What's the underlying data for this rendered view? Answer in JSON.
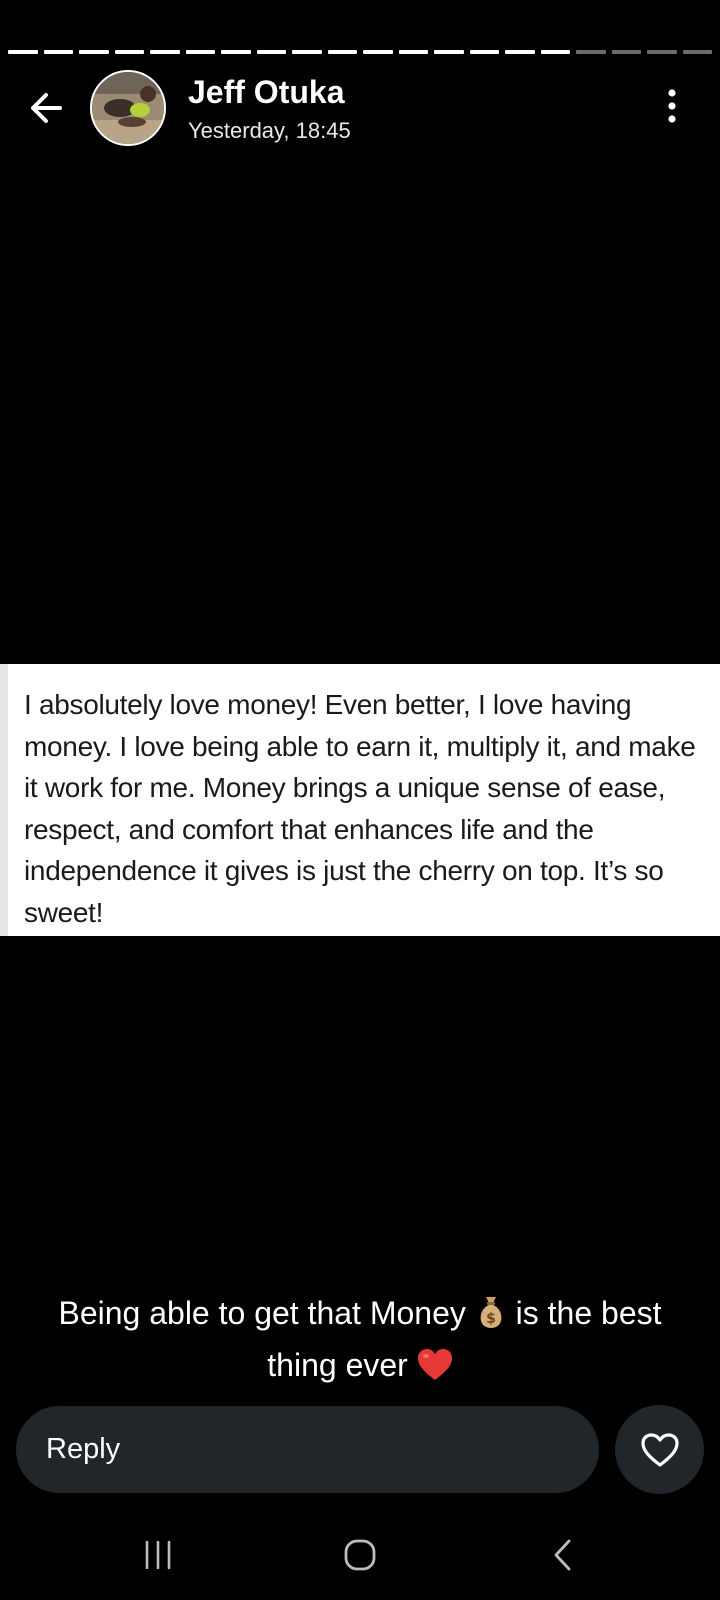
{
  "story": {
    "segments_total": 20,
    "segments_viewed": 16
  },
  "header": {
    "name": "Jeff Otuka",
    "time": "Yesterday, 18:45"
  },
  "post": {
    "text": "I absolutely love money! Even better, I love having money. I love being able to earn it, multiply it, and make it work for me. Money brings a unique sense of ease, respect, and comfort that enhances life and the independence it gives is just the cherry on top. It’s so sweet!"
  },
  "caption": {
    "part1": "Being able to get that Money",
    "part2": "is the best thing ever"
  },
  "reply": {
    "label": "Reply"
  },
  "icons": {
    "back": "back-arrow-icon",
    "menu": "more-vertical-icon",
    "like": "heart-outline-icon",
    "money": "money-bag-icon",
    "heart": "red-heart-icon",
    "recents": "recents-icon",
    "home": "home-icon",
    "nav_back": "nav-back-icon"
  },
  "colors": {
    "background": "#000000",
    "surface": "#21262b",
    "card": "#ffffff",
    "heart_red": "#e53935"
  }
}
